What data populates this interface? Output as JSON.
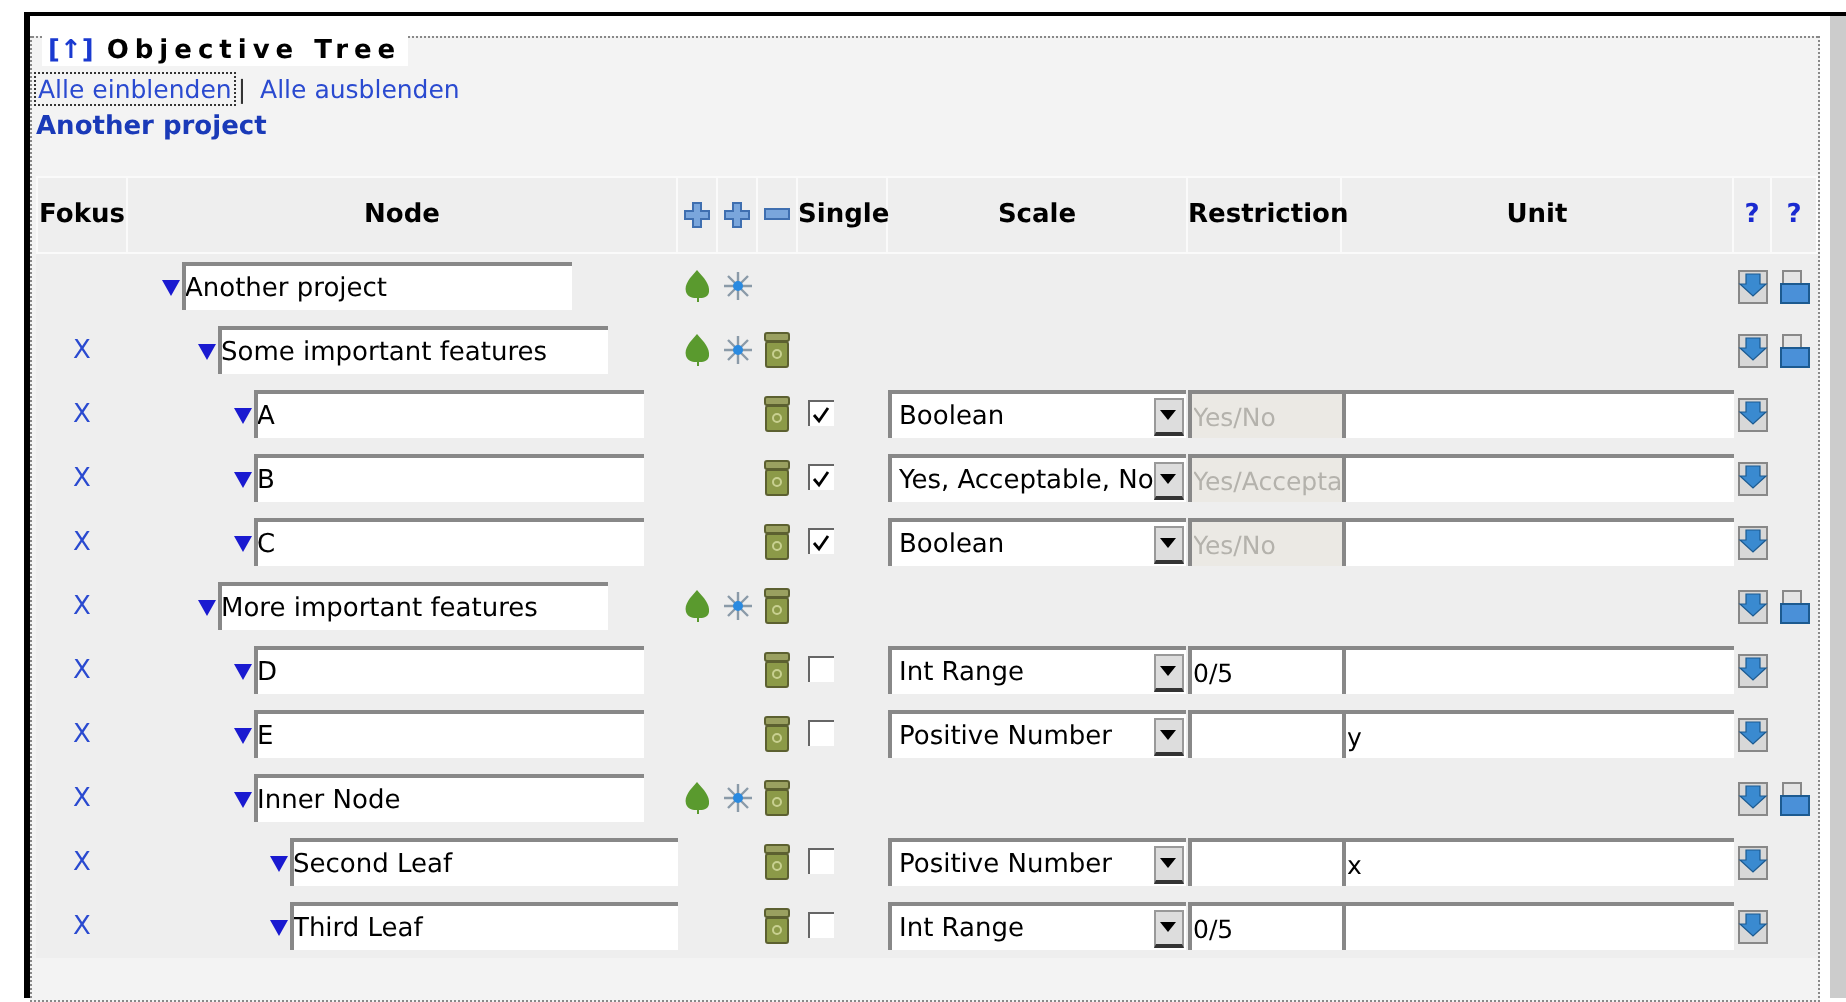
{
  "title_link": "[↑]",
  "title": "Objective Tree",
  "links": [
    {
      "label": "Alle einblenden",
      "focused": true
    },
    {
      "label": "Alle ausblenden",
      "focused": false
    }
  ],
  "link_separator": "|",
  "project": "Another project",
  "columns": [
    "Fokus",
    "Node",
    "Single",
    "Scale",
    "Restriction",
    "Unit"
  ],
  "help_columns": [
    "?",
    "?"
  ],
  "tree": [
    {
      "kind": "project",
      "name": "Another project",
      "children": [
        {
          "kind": "group",
          "fokus": "X",
          "name": "Some important features",
          "children": [
            {
              "kind": "leaf",
              "fokus": "X",
              "name": "A",
              "single": true,
              "scale": "Boolean",
              "restriction": "Yes/No",
              "restriction_disabled": true
            },
            {
              "kind": "leaf",
              "fokus": "X",
              "name": "B",
              "single": true,
              "scale": "Yes, Acceptable, No",
              "restriction": "Yes/Accepta",
              "restriction_disabled": true
            },
            {
              "kind": "leaf",
              "fokus": "X",
              "name": "C",
              "single": true,
              "scale": "Boolean",
              "restriction": "Yes/No",
              "restriction_disabled": true
            }
          ]
        },
        {
          "kind": "group",
          "fokus": "X",
          "name": "More important features",
          "children": [
            {
              "kind": "leaf",
              "fokus": "X",
              "name": "D",
              "single": false,
              "scale": "Int Range",
              "restriction": "0/5",
              "restriction_disabled": false
            },
            {
              "kind": "leaf",
              "fokus": "X",
              "name": "E",
              "single": false,
              "scale": "Positive Number",
              "restriction_disabled": false,
              "unit": "y"
            },
            {
              "kind": "group",
              "fokus": "X",
              "name": "Inner Node",
              "children": [
                {
                  "kind": "leaf",
                  "fokus": "X",
                  "name": "Second Leaf",
                  "single": false,
                  "scale": "Positive Number",
                  "restriction_disabled": false,
                  "unit": "x"
                },
                {
                  "kind": "leaf",
                  "fokus": "X",
                  "name": "Third Leaf",
                  "single": false,
                  "scale": "Int Range",
                  "restriction": "0/5",
                  "restriction_disabled": false
                }
              ]
            }
          ]
        }
      ]
    }
  ]
}
